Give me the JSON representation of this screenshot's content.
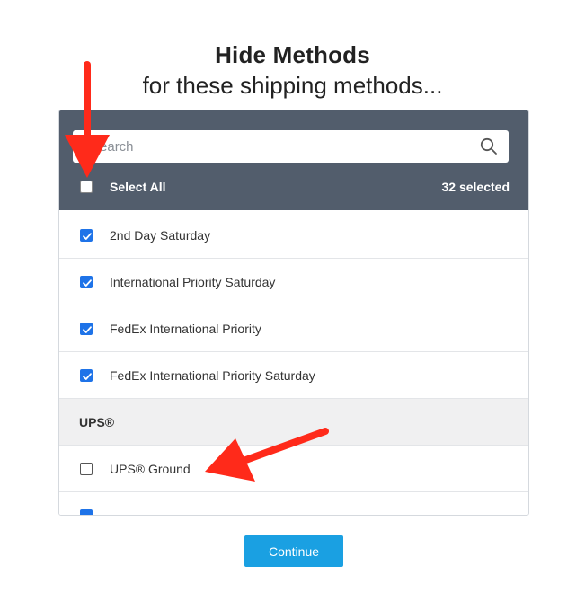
{
  "header": {
    "title": "Hide Methods",
    "subtitle": "for these shipping methods..."
  },
  "search": {
    "placeholder": "Search"
  },
  "select_all": {
    "label": "Select All",
    "checked": false,
    "count_text": "32 selected"
  },
  "rows": [
    {
      "label": "2nd Day Saturday",
      "checked": true
    },
    {
      "label": "International Priority Saturday",
      "checked": true
    },
    {
      "label": "FedEx International Priority",
      "checked": true
    },
    {
      "label": "FedEx International Priority Saturday",
      "checked": true
    },
    {
      "label": "UPS®",
      "group": true
    },
    {
      "label": "UPS® Ground",
      "checked": false
    }
  ],
  "footer": {
    "continue_label": "Continue"
  },
  "colors": {
    "header_bg": "#525d6c",
    "checkbox_checked": "#1e73e8",
    "button_bg": "#1aa0e2",
    "annotation_arrow": "#ff2a1a"
  }
}
